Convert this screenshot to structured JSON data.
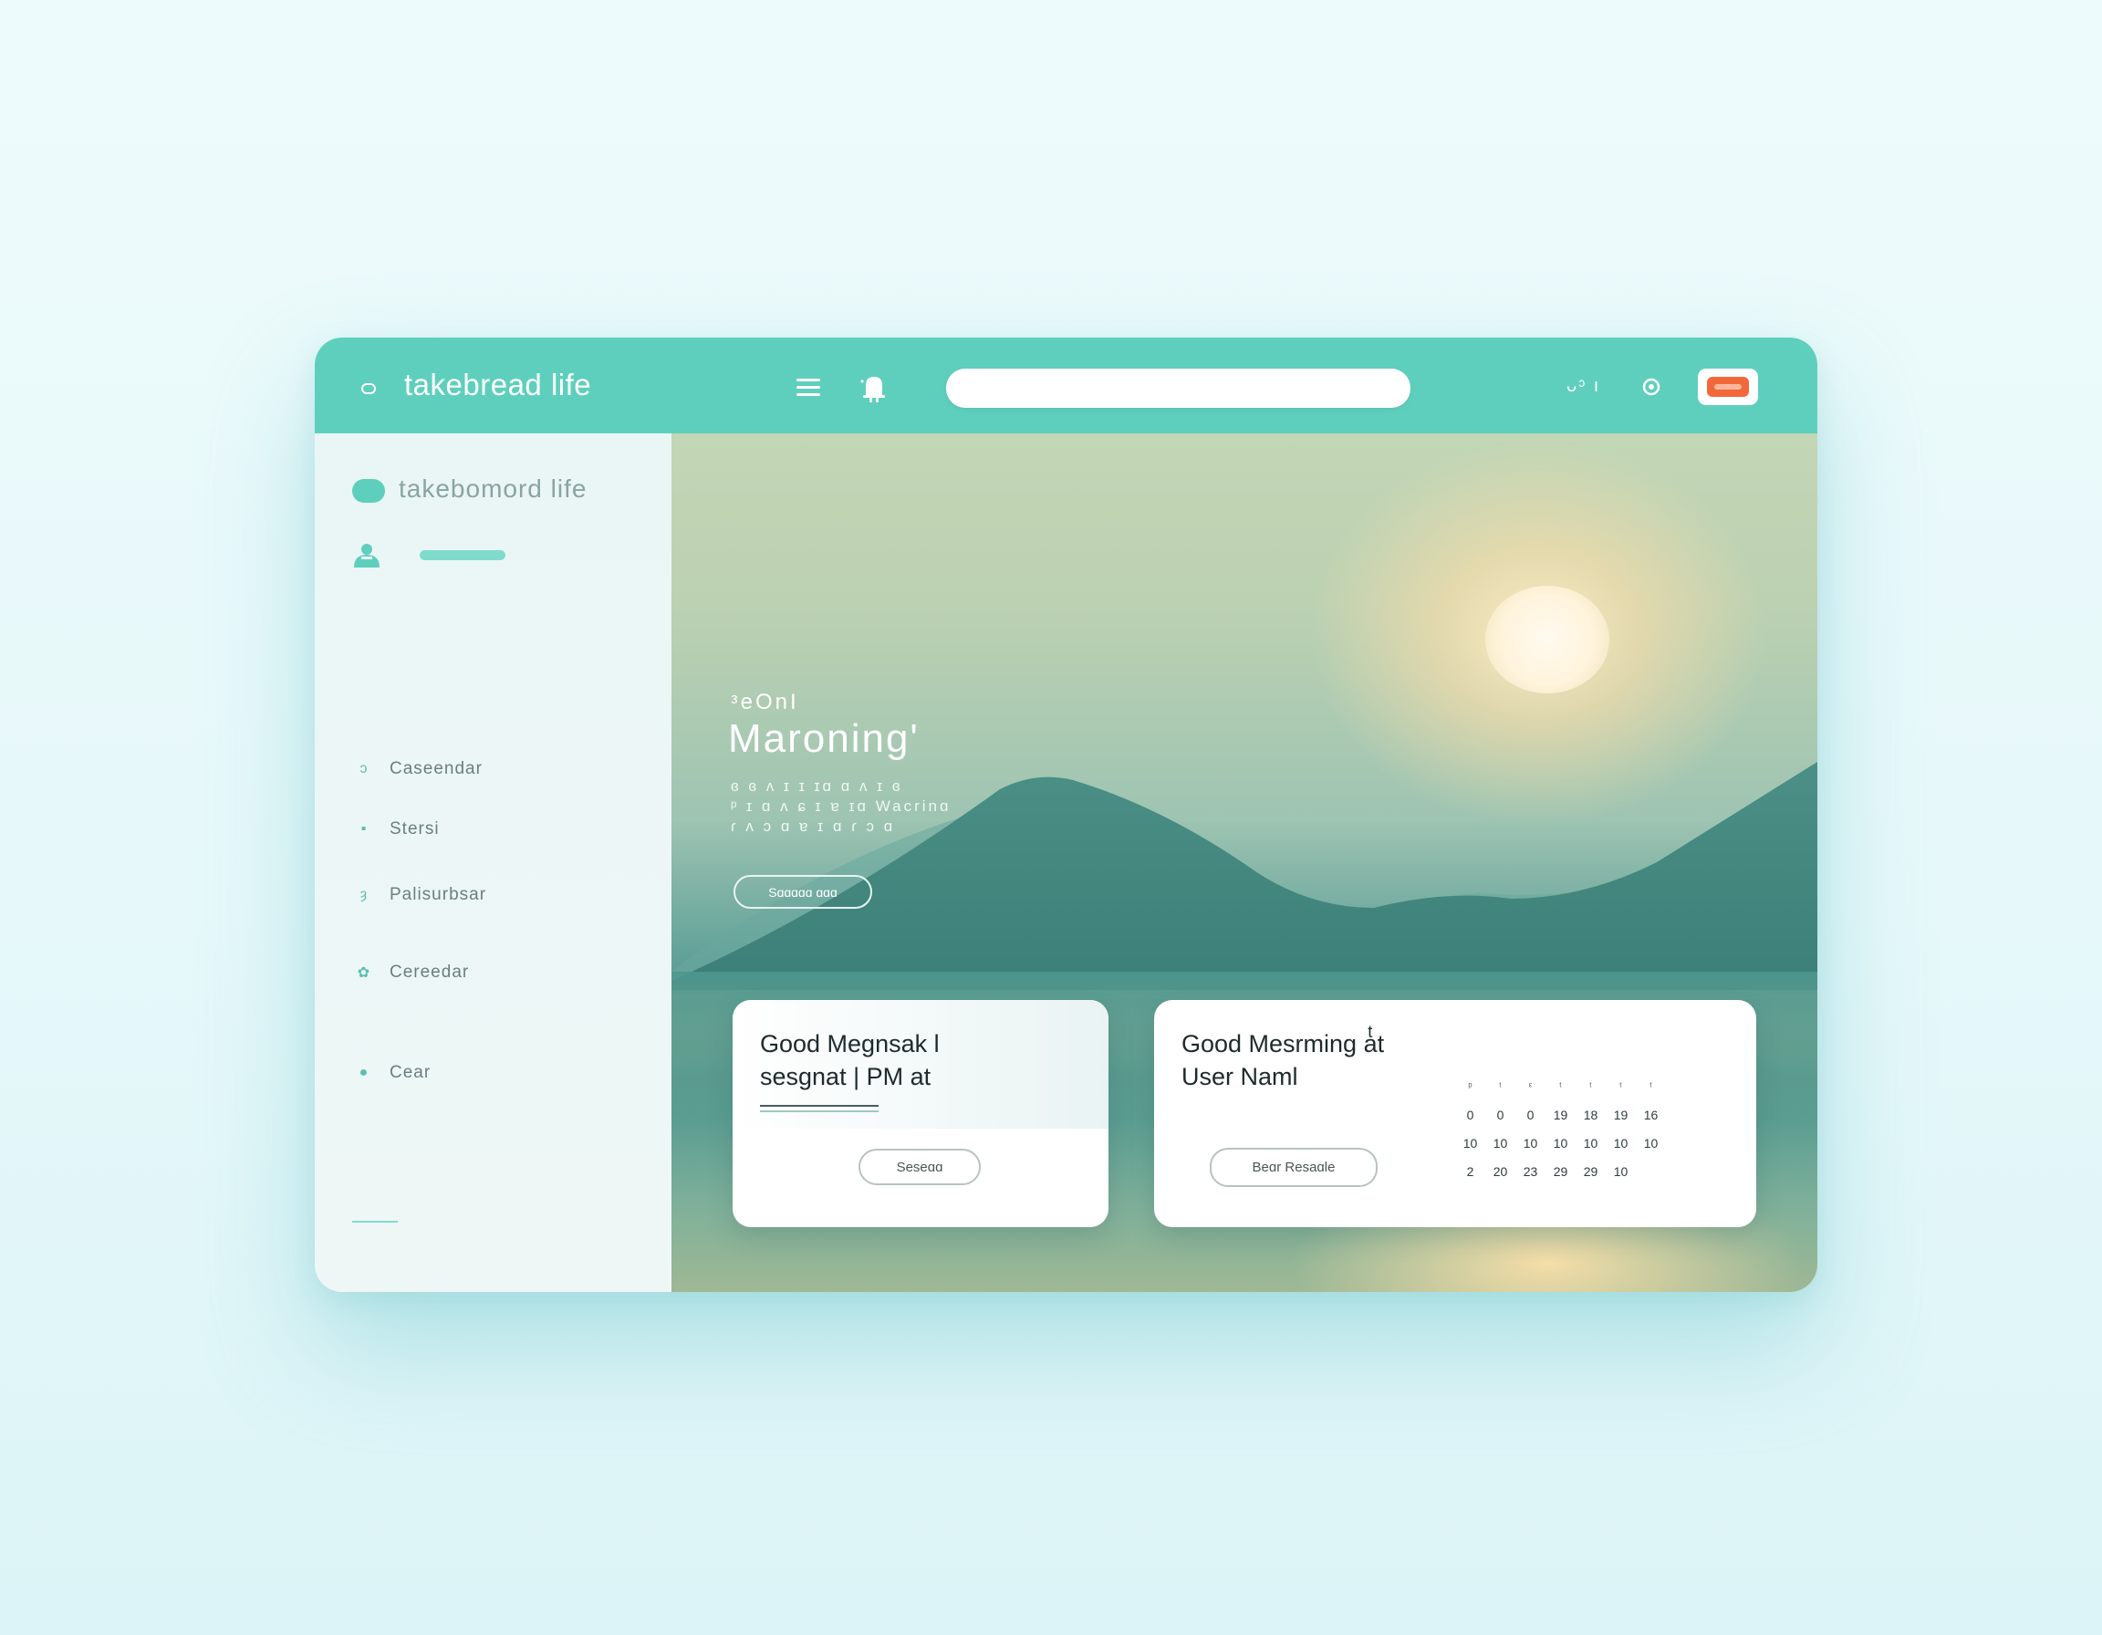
{
  "header": {
    "brand": "takebread life",
    "search_placeholder": "",
    "right_text": "ᴗᵓ  ı"
  },
  "sidebar": {
    "title": "takebomord life",
    "items": [
      {
        "label": "Caseendar",
        "icon": "calendar-icon"
      },
      {
        "label": "Stersi",
        "icon": "note-icon"
      },
      {
        "label": "Palisurbsar",
        "icon": "leaf-icon"
      },
      {
        "label": "Cereedar",
        "icon": "settings-icon"
      },
      {
        "label": "Cear",
        "icon": "circle-icon"
      }
    ]
  },
  "hero": {
    "small": "ᵌeOnI",
    "title": "Maroning'",
    "subtitle": [
      "ɞ ɞ ʌ ɪ ɪ ɪɑ ɑ ʌ ɪ ɞ",
      "ᵖ ɪ ɑ ʌ ɕ ɪ ɐ ɪɑ Wacrinɑ",
      "ɾ ʌ ɔ ɑ ɐ ɪ ɑ ɾ ɔ ɑ"
    ],
    "button": "Sɑɑɑɑɑ ɑɑɑ"
  },
  "cards": {
    "card1": {
      "title_line1": "Good Megnsak l",
      "title_line2": "sesgnat | PM at",
      "button": "Seseɑɑ"
    },
    "card2": {
      "title_line1": "Good Mesrming aͭt",
      "title_line2": "User Naml",
      "button": "Beɑr Resaɑle"
    }
  },
  "calendar": {
    "header": [
      "ᵖ",
      "ᵗ",
      "ᵋ",
      "ᵗ",
      "ᵗ",
      "ᵗ",
      "ᵗ"
    ],
    "rows": [
      [
        "0",
        "0",
        "0",
        "19",
        "18",
        "19",
        "16"
      ],
      [
        "10",
        "10",
        "10",
        "10",
        "10",
        "10",
        "10"
      ],
      [
        "2",
        "20",
        "23",
        "29",
        "29",
        "10",
        ""
      ]
    ]
  },
  "colors": {
    "header": "#5fcfbd",
    "accent": "#5fcfbd",
    "avatar": "#f2683b",
    "sidebar": "#eef7f6"
  }
}
